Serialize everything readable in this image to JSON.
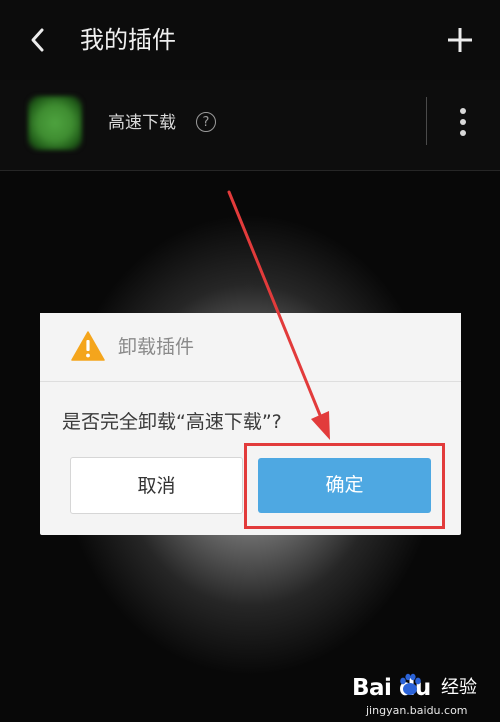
{
  "header": {
    "title": "我的插件"
  },
  "plugin": {
    "name": "高速下载",
    "help_glyph": "?"
  },
  "dialog": {
    "title": "卸载插件",
    "message": "是否完全卸载“高速下载”?",
    "cancel_label": "取消",
    "confirm_label": "确定"
  },
  "watermark": {
    "logo_text": "Bai du",
    "jingyan": "经验",
    "url": "jingyan.baidu.com"
  },
  "colors": {
    "confirm_button": "#4ea8e2",
    "annotation_red": "#e23b3b",
    "warning_orange": "#f4a51c"
  }
}
